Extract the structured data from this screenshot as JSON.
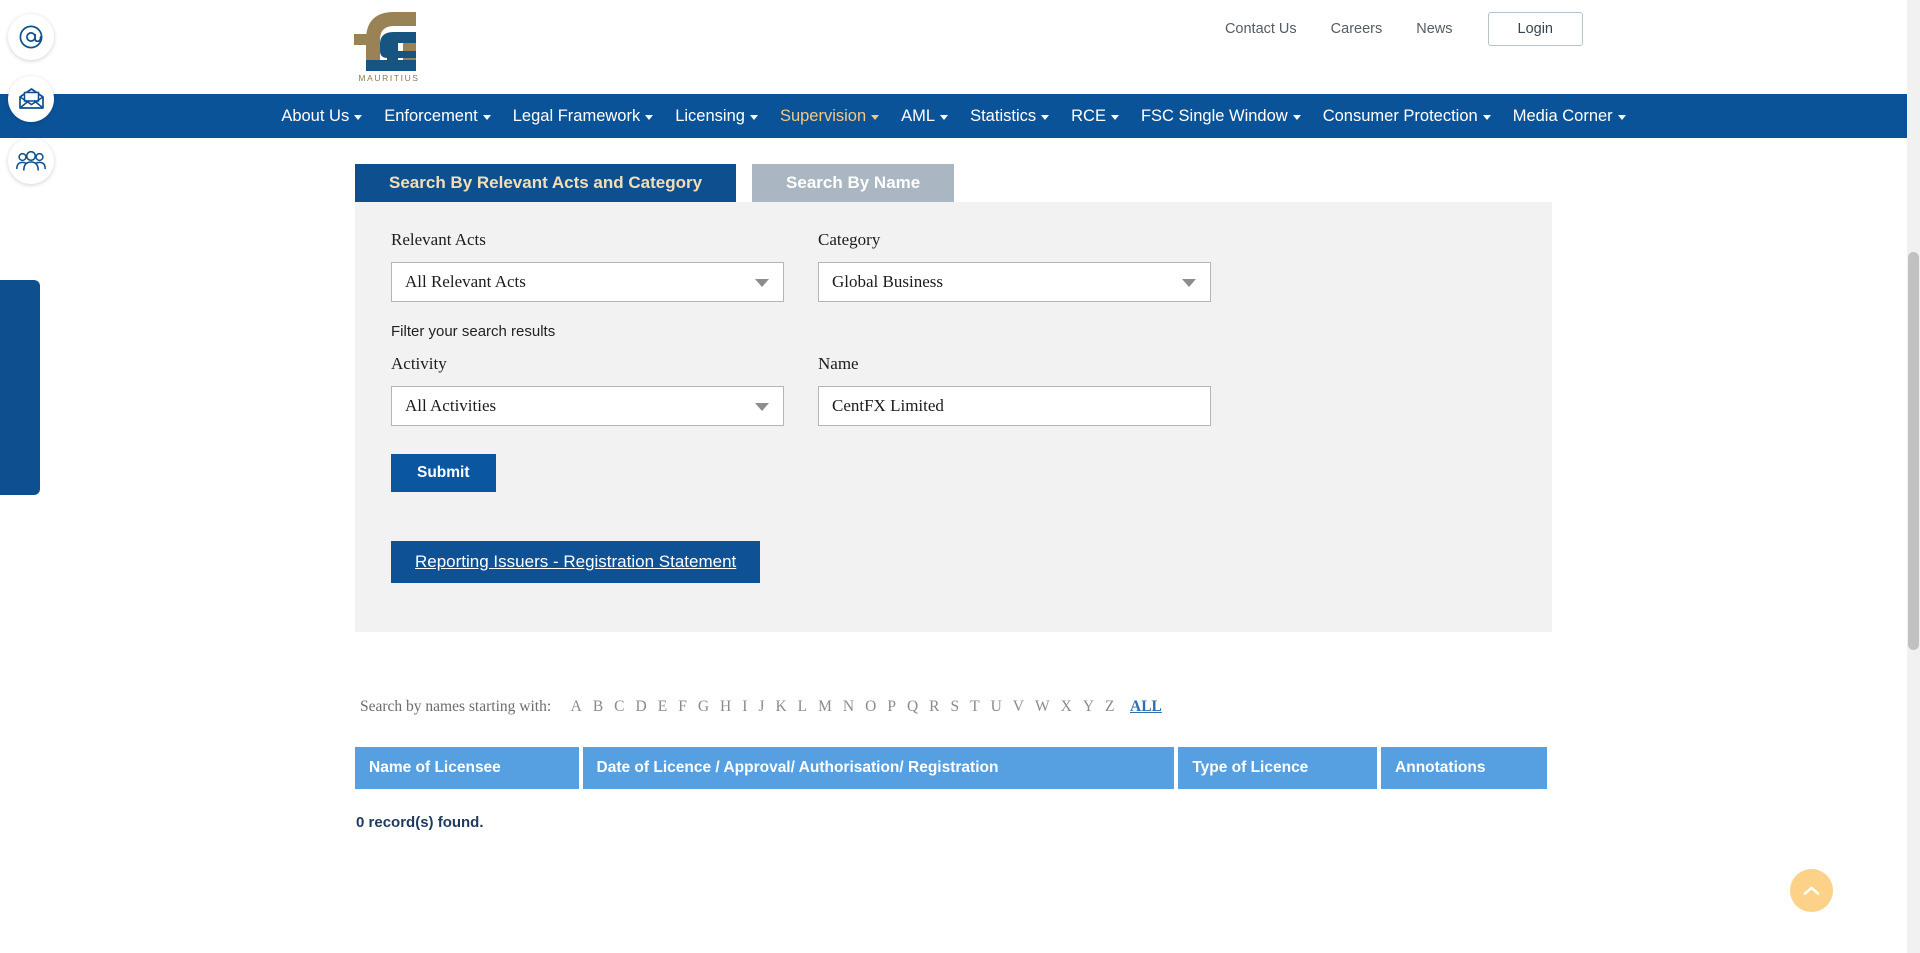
{
  "header": {
    "logo_text": "MAURITIUS",
    "logo_name": "fsc-mauritius-logo",
    "top_links": [
      {
        "label": "Contact Us"
      },
      {
        "label": "Careers"
      },
      {
        "label": "News"
      }
    ],
    "login_label": "Login"
  },
  "mainnav": {
    "items": [
      {
        "label": "About Us",
        "has_caret": true,
        "active": false
      },
      {
        "label": "Enforcement",
        "has_caret": true,
        "active": false
      },
      {
        "label": "Legal Framework",
        "has_caret": true,
        "active": false
      },
      {
        "label": "Licensing",
        "has_caret": true,
        "active": false
      },
      {
        "label": "Supervision",
        "has_caret": true,
        "active": true
      },
      {
        "label": "AML",
        "has_caret": true,
        "active": false
      },
      {
        "label": "Statistics",
        "has_caret": true,
        "active": false
      },
      {
        "label": "RCE",
        "has_caret": true,
        "active": false
      },
      {
        "label": "FSC Single Window",
        "has_caret": true,
        "active": false
      },
      {
        "label": "Consumer Protection",
        "has_caret": true,
        "active": false
      },
      {
        "label": "Media Corner",
        "has_caret": true,
        "active": false
      }
    ],
    "active_color": "#f0c987",
    "bar_color": "#0b5398"
  },
  "tabs": {
    "active_label": "Search By Relevant Acts and Category",
    "inactive_label": "Search By Name"
  },
  "form": {
    "relevant_acts_label": "Relevant Acts",
    "relevant_acts_value": "All Relevant Acts",
    "category_label": "Category",
    "category_value": "Global Business",
    "filter_note": "Filter your search results",
    "activity_label": "Activity",
    "activity_value": "All Activities",
    "name_label": "Name",
    "name_value": "CentFX Limited",
    "name_placeholder": "",
    "submit_label": "Submit",
    "reporting_label": "Reporting Issuers - Registration Statement"
  },
  "alphabet": {
    "label": "Search by names starting with:",
    "letters": [
      "A",
      "B",
      "C",
      "D",
      "E",
      "F",
      "G",
      "H",
      "I",
      "J",
      "K",
      "L",
      "M",
      "N",
      "O",
      "P",
      "Q",
      "R",
      "S",
      "T",
      "U",
      "V",
      "W",
      "X",
      "Y",
      "Z"
    ],
    "all_label": "ALL",
    "all_color": "#2f6fad"
  },
  "table": {
    "headers": [
      "Name of Licensee",
      "Date of Licence / Approval/ Authorisation/ Registration",
      "Type of Licence",
      "Annotations"
    ],
    "header_color": "#56a0e2",
    "rows": [],
    "records_text": "0 record(s) found."
  },
  "side_strip": {
    "icons": [
      {
        "name": "at-symbol-icon"
      },
      {
        "name": "open-envelope-icon"
      },
      {
        "name": "people-group-icon"
      }
    ],
    "strip_color": "#0e4f8f"
  },
  "scroll_top": {
    "name": "scroll-to-top-button",
    "color": "#fbd287"
  }
}
